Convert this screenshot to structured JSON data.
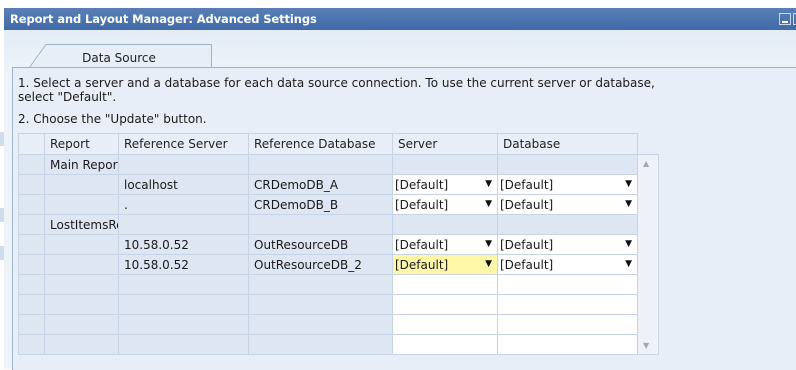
{
  "window": {
    "title": "Report and Layout Manager: Advanced Settings"
  },
  "tabs": [
    {
      "label": "Data Source"
    }
  ],
  "instructions": {
    "line1": "1. Select a server and a database for each data source connection. To use the current server or database,",
    "line2": "select \"Default\".",
    "line3": "2. Choose the \"Update\" button."
  },
  "grid": {
    "headers": {
      "report": "Report",
      "ref_server": "Reference Server",
      "ref_database": "Reference Database",
      "server": "Server",
      "database": "Database"
    },
    "rows": [
      {
        "report": "Main Report",
        "ref_server": "",
        "ref_database": "",
        "server": "",
        "database": ""
      },
      {
        "report": "",
        "ref_server": "localhost",
        "ref_database": "CRDemoDB_A",
        "server": "[Default]",
        "database": "[Default]"
      },
      {
        "report": "",
        "ref_server": ".",
        "ref_database": "CRDemoDB_B",
        "server": "[Default]",
        "database": "[Default]"
      },
      {
        "report": "LostItemsRe",
        "ref_server": "",
        "ref_database": "",
        "server": "",
        "database": ""
      },
      {
        "report": "",
        "ref_server": "10.58.0.52",
        "ref_database": "OutResourceDB",
        "server": "[Default]",
        "database": "[Default]"
      },
      {
        "report": "",
        "ref_server": "10.58.0.52",
        "ref_database": "OutResourceDB_2",
        "server": "[Default]",
        "database": "[Default]"
      }
    ]
  },
  "colors": {
    "titlebar": "#4a74b0",
    "active_cell": "#fff7a8",
    "readonly_cell": "#dde6f2"
  },
  "icons": {
    "minimize": "minimize-icon",
    "dropdown": "chevron-down-icon"
  }
}
